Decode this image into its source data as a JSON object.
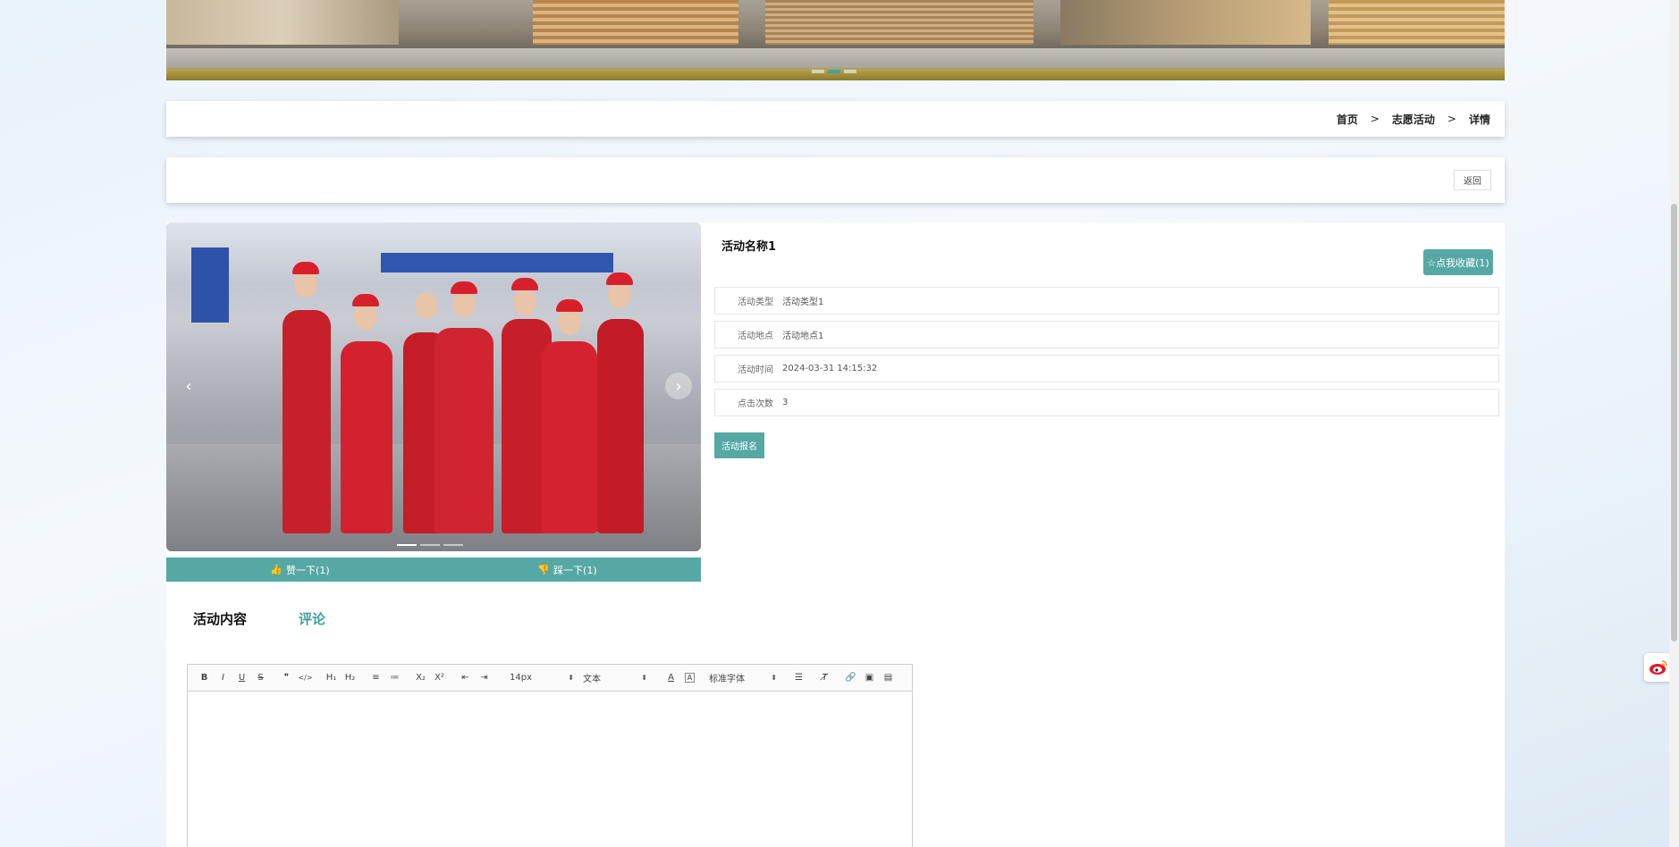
{
  "breadcrumb": {
    "items": [
      "首页",
      "志愿活动",
      "详情"
    ],
    "separator": ">"
  },
  "back_label": "返回",
  "activity": {
    "title": "活动名称1",
    "favorite_label": "☆点我收藏(1)",
    "fields": [
      {
        "label": "活动类型",
        "value": "活动类型1"
      },
      {
        "label": "活动地点",
        "value": "活动地点1"
      },
      {
        "label": "活动时间",
        "value": "2024-03-31 14:15:32"
      },
      {
        "label": "点击次数",
        "value": "3"
      }
    ],
    "signup_label": "活动报名"
  },
  "votes": {
    "up_label": "赞一下(1)",
    "down_label": "踩一下(1)"
  },
  "tabs": [
    {
      "label": "活动内容",
      "active": false
    },
    {
      "label": "评论",
      "active": true
    }
  ],
  "editor": {
    "font_size": "14px",
    "block_type": "文本",
    "font_family": "标准字体",
    "tools": [
      "B",
      "I",
      "U",
      "S",
      "❞",
      "</>",
      "H₁",
      "H₂",
      "≡",
      "≔",
      "X₂",
      "X²",
      "⇤",
      "⇥"
    ]
  },
  "colors": {
    "accent": "#56a8a4",
    "tab_active": "#3d9f9a"
  }
}
